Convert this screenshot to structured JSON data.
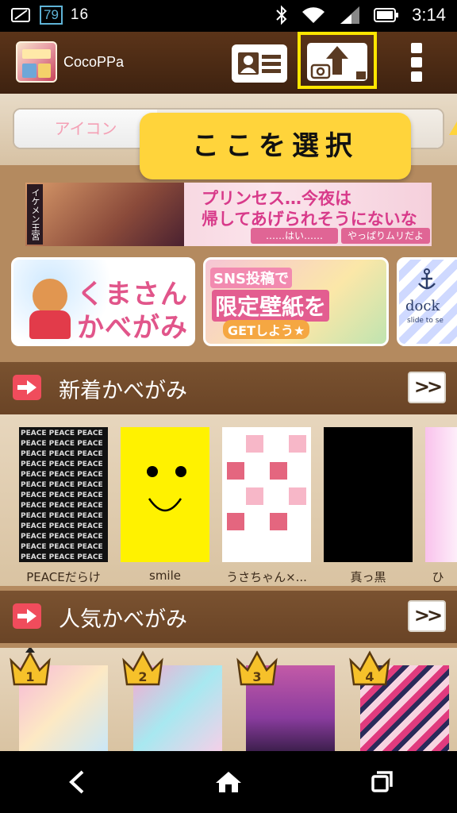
{
  "status_bar": {
    "battery_level": "79",
    "notif_count": "16",
    "time": "3:14"
  },
  "app_bar": {
    "title": "CocoPPa"
  },
  "tabs": {
    "icon_tab": "アイコン"
  },
  "tooltip": {
    "text": "ここを選択"
  },
  "banner": {
    "side_label": "イケメン王宮",
    "line1": "プリンセス…今夜は",
    "line2": "帰してあげられそうにないな",
    "choice1": "……はい……",
    "choice2": "やっぱりムリだよ"
  },
  "promos": {
    "bear_line1": "くまさん",
    "bear_line2": "かべがみ",
    "sns_line1": "SNS投稿で",
    "sns_line2": "限定壁紙を",
    "sns_line3": "GETしよう★",
    "dock_title": "dock",
    "dock_sub": "slide to se"
  },
  "new_section": {
    "title": "新着かべがみ",
    "more": ">>",
    "items": [
      {
        "label": "PEACEだらけ"
      },
      {
        "label": "smile"
      },
      {
        "label": "うさちゃん×..."
      },
      {
        "label": "真っ黒"
      },
      {
        "label": "ひ"
      }
    ]
  },
  "popular_section": {
    "title": "人気かべがみ",
    "more": ">>",
    "ranks": [
      "1",
      "2",
      "3",
      "4"
    ]
  },
  "colors": {
    "accent_red": "#f04c5c",
    "highlight_yellow": "#ffd43b",
    "frame_yellow": "#ffe600",
    "wood_dark": "#6a4426"
  }
}
